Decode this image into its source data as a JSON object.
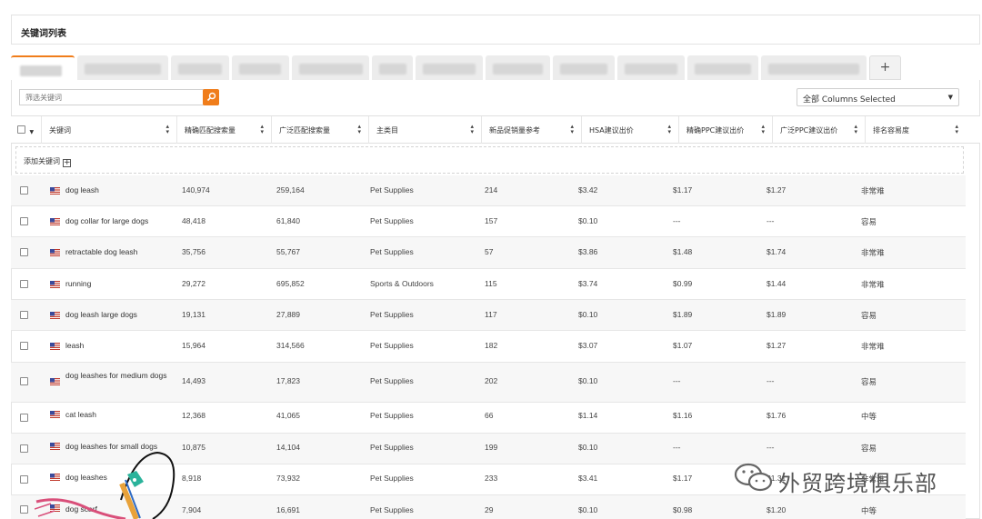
{
  "card": {
    "title": "关键词列表"
  },
  "toolbar": {
    "search_placeholder": "筛选关键词",
    "columns_select": "全部 Columns Selected"
  },
  "table": {
    "headers": [
      "关键词",
      "精确匹配搜索量",
      "广泛匹配搜索量",
      "主类目",
      "新品促销量参考",
      "HSA建议出价",
      "精确PPC建议出价",
      "广泛PPC建议出价",
      "排名容易度"
    ],
    "add_keyword": "添加关键词",
    "rows": [
      {
        "keyword": "dog leash",
        "exact": "140,974",
        "broad": "259,164",
        "category": "Pet Supplies",
        "promo": "214",
        "hsa": "$3.42",
        "ppc_exact": "$1.17",
        "ppc_broad": "$1.27",
        "ease": "非常难"
      },
      {
        "keyword": "dog collar for large dogs",
        "exact": "48,418",
        "broad": "61,840",
        "category": "Pet Supplies",
        "promo": "157",
        "hsa": "$0.10",
        "ppc_exact": "---",
        "ppc_broad": "---",
        "ease": "容易"
      },
      {
        "keyword": "retractable dog leash",
        "exact": "35,756",
        "broad": "55,767",
        "category": "Pet Supplies",
        "promo": "57",
        "hsa": "$3.86",
        "ppc_exact": "$1.48",
        "ppc_broad": "$1.74",
        "ease": "非常难"
      },
      {
        "keyword": "running",
        "exact": "29,272",
        "broad": "695,852",
        "category": "Sports & Outdoors",
        "promo": "115",
        "hsa": "$3.74",
        "ppc_exact": "$0.99",
        "ppc_broad": "$1.44",
        "ease": "非常难"
      },
      {
        "keyword": "dog leash large dogs",
        "exact": "19,131",
        "broad": "27,889",
        "category": "Pet Supplies",
        "promo": "117",
        "hsa": "$0.10",
        "ppc_exact": "$1.89",
        "ppc_broad": "$1.89",
        "ease": "容易"
      },
      {
        "keyword": "leash",
        "exact": "15,964",
        "broad": "314,566",
        "category": "Pet Supplies",
        "promo": "182",
        "hsa": "$3.07",
        "ppc_exact": "$1.07",
        "ppc_broad": "$1.27",
        "ease": "非常难"
      },
      {
        "keyword": "dog leashes for medium dogs",
        "exact": "14,493",
        "broad": "17,823",
        "category": "Pet Supplies",
        "promo": "202",
        "hsa": "$0.10",
        "ppc_exact": "---",
        "ppc_broad": "---",
        "ease": "容易"
      },
      {
        "keyword": "cat leash",
        "exact": "12,368",
        "broad": "41,065",
        "category": "Pet Supplies",
        "promo": "66",
        "hsa": "$1.14",
        "ppc_exact": "$1.16",
        "ppc_broad": "$1.76",
        "ease": "中等"
      },
      {
        "keyword": "dog leashes for small dogs",
        "exact": "10,875",
        "broad": "14,104",
        "category": "Pet Supplies",
        "promo": "199",
        "hsa": "$0.10",
        "ppc_exact": "---",
        "ppc_broad": "---",
        "ease": "容易"
      },
      {
        "keyword": "dog leashes",
        "exact": "8,918",
        "broad": "73,932",
        "category": "Pet Supplies",
        "promo": "233",
        "hsa": "$3.41",
        "ppc_exact": "$1.17",
        "ppc_broad": "$1.31",
        "ease": "非常难"
      },
      {
        "keyword": "dog scarf",
        "exact": "7,904",
        "broad": "16,691",
        "category": "Pet Supplies",
        "promo": "29",
        "hsa": "$0.10",
        "ppc_exact": "$0.98",
        "ppc_broad": "$1.20",
        "ease": "中等"
      }
    ]
  },
  "watermark": {
    "text": "外贸跨境俱乐部"
  },
  "tabs": {
    "add_label": "+"
  },
  "colors": {
    "accent": "#f07d1a",
    "flag_red": "#c0392b",
    "flag_blue": "#3b4a9b"
  }
}
